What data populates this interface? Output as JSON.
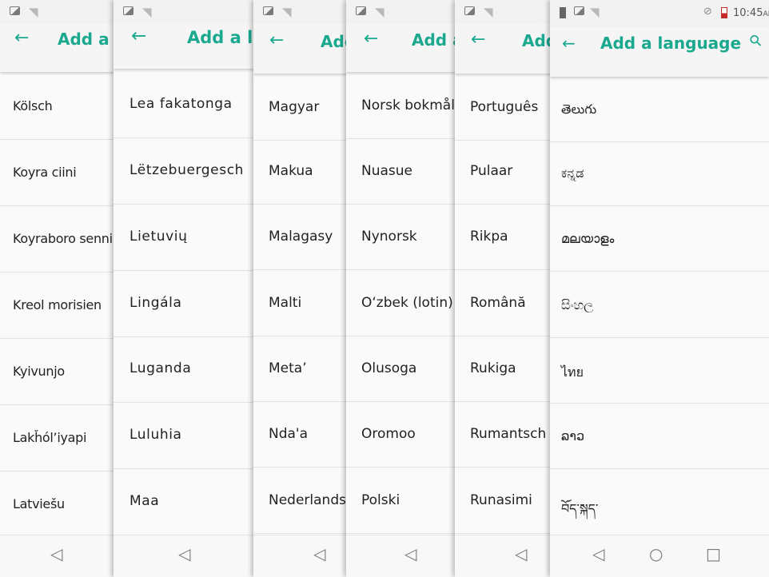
{
  "colors": {
    "accent": "#1aa88e",
    "text": "#222222",
    "divider": "#e2e2e2",
    "background": "#fafafa"
  },
  "status_bar": {
    "time": "10:45",
    "ampm": "AM"
  },
  "header": {
    "title": "Add a language"
  },
  "panels": [
    {
      "title_visible": "Add a la",
      "items": [
        "Kölsch",
        "Koyra ciini",
        "Koyraboro senni",
        "Kreol morisien",
        "Kyivunjo",
        "Lakȟól’iyapi",
        "Latviešu"
      ]
    },
    {
      "title_visible": "Add a la",
      "items": [
        "Lea fakatonga",
        "Lëtzebuergesch",
        "Lietuvių",
        "Lingála",
        "Luganda",
        "Luluhia",
        "Maa"
      ]
    },
    {
      "title_visible": "Add",
      "items": [
        "Magyar",
        "Makua",
        "Malagasy",
        "Malti",
        "Metaʼ",
        "Ndaꞌa",
        "Nederlands"
      ]
    },
    {
      "title_visible": "Add a",
      "items": [
        "Norsk bokmål",
        "Nuasue",
        "Nynorsk",
        "Oʻzbek (lotin)",
        "Olusoga",
        "Oromoo",
        "Polski"
      ]
    },
    {
      "title_visible": "Add",
      "items": [
        "Português",
        "Pulaar",
        "Rikpa",
        "Română",
        "Rukiga",
        "Rumantsch",
        "Runasimi"
      ]
    },
    {
      "title_visible": "Add a language",
      "items": [
        "తెలుగు",
        "ಕನ್ನಡ",
        "മലയാളം",
        "සිංහල",
        "ไทย",
        "ລາວ",
        "བོད་སྐད་"
      ]
    }
  ],
  "icons": {
    "back": "arrow-left-icon",
    "search": "search-icon",
    "nav_back": "triangle-back-icon",
    "nav_home": "circle-home-icon",
    "nav_recents": "square-recents-icon"
  }
}
